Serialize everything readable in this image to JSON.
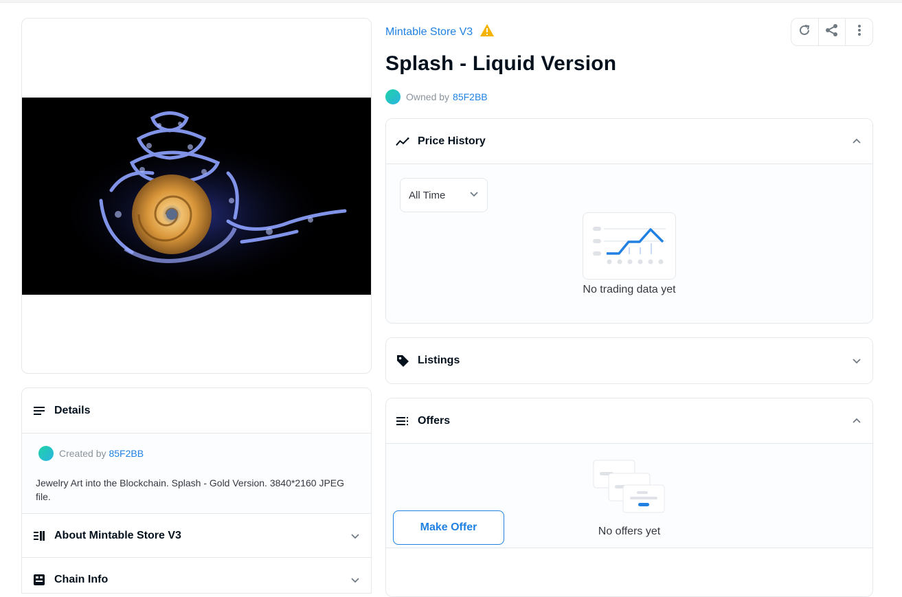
{
  "collection": {
    "name": "Mintable Store V3",
    "warning_icon": "warning-icon"
  },
  "item": {
    "title": "Splash - Liquid Version",
    "owned_by_label": "Owned by",
    "owner": "85F2BB"
  },
  "actions": {
    "icons": [
      "refresh-icon",
      "share-icon",
      "more-icon"
    ]
  },
  "price_history": {
    "header": "Price History",
    "filter": "All Time",
    "empty_text": "No trading data yet"
  },
  "listings": {
    "header": "Listings"
  },
  "offers": {
    "header": "Offers",
    "empty_text": "No offers yet",
    "make_offer_label": "Make Offer"
  },
  "details": {
    "header": "Details",
    "created_by_label": "Created by",
    "creator": "85F2BB",
    "description": "Jewelry Art into the Blockchain. Splash - Gold Version. 3840*2160 JPEG file."
  },
  "about": {
    "header": "About Mintable Store V3"
  },
  "chain_info": {
    "header": "Chain Info"
  },
  "colors": {
    "accent": "#2081e2",
    "border": "#e5e8eb",
    "warning": "#f5b300"
  }
}
